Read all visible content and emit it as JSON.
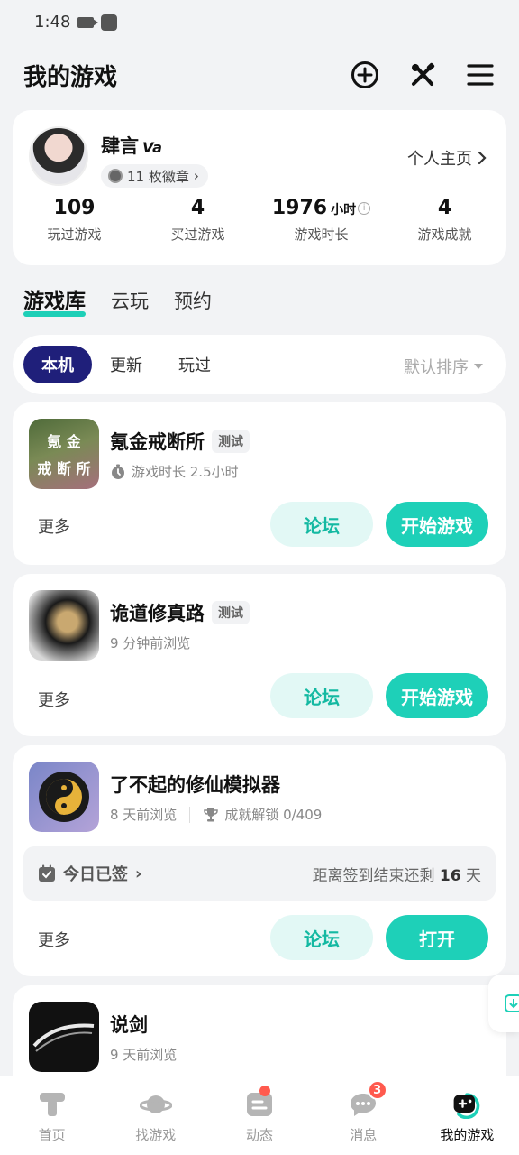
{
  "status_bar": {
    "time": "1:48"
  },
  "header": {
    "title": "我的游戏"
  },
  "profile": {
    "name": "肆言",
    "flair": "Va",
    "badges": "11 枚徽章",
    "homepage_link": "个人主页",
    "stats": [
      {
        "value": "109",
        "label": "玩过游戏"
      },
      {
        "value": "4",
        "label": "买过游戏"
      },
      {
        "value": "1976",
        "unit": "小时",
        "label": "游戏时长"
      },
      {
        "value": "4",
        "label": "游戏成就"
      }
    ]
  },
  "main_tabs": [
    {
      "label": "游戏库"
    },
    {
      "label": "云玩"
    },
    {
      "label": "预约"
    }
  ],
  "filter": {
    "chips": [
      {
        "label": "本机"
      },
      {
        "label": "更新"
      },
      {
        "label": "玩过"
      }
    ],
    "sort_label": "默认排序"
  },
  "games": [
    {
      "name": "氪金戒断所",
      "tag": "测试",
      "meta": "游戏时长 2.5小时",
      "cover_text_1": "氪 金",
      "cover_text_2": "戒 断 所",
      "more": "更多",
      "forum": "论坛",
      "action": "开始游戏"
    },
    {
      "name": "诡道修真路",
      "tag": "测试",
      "meta": "9 分钟前浏览",
      "more": "更多",
      "forum": "论坛",
      "action": "开始游戏"
    },
    {
      "name": "了不起的修仙模拟器",
      "meta": "8 天前浏览",
      "meta2": "成就解锁 0/409",
      "signin_status": "今日已签",
      "signin_prefix": "距离签到结束还剩",
      "signin_days": "16",
      "signin_suffix": "天",
      "more": "更多",
      "forum": "论坛",
      "action": "打开"
    },
    {
      "name": "说剑",
      "meta": "9 天前浏览"
    }
  ],
  "bottom_nav": [
    {
      "label": "首页"
    },
    {
      "label": "找游戏"
    },
    {
      "label": "动态"
    },
    {
      "label": "消息",
      "badge": "3"
    },
    {
      "label": "我的游戏"
    }
  ],
  "colors": {
    "accent": "#1ed0b8",
    "chip_active": "#1f1f7a",
    "badge": "#ff5a4e"
  }
}
